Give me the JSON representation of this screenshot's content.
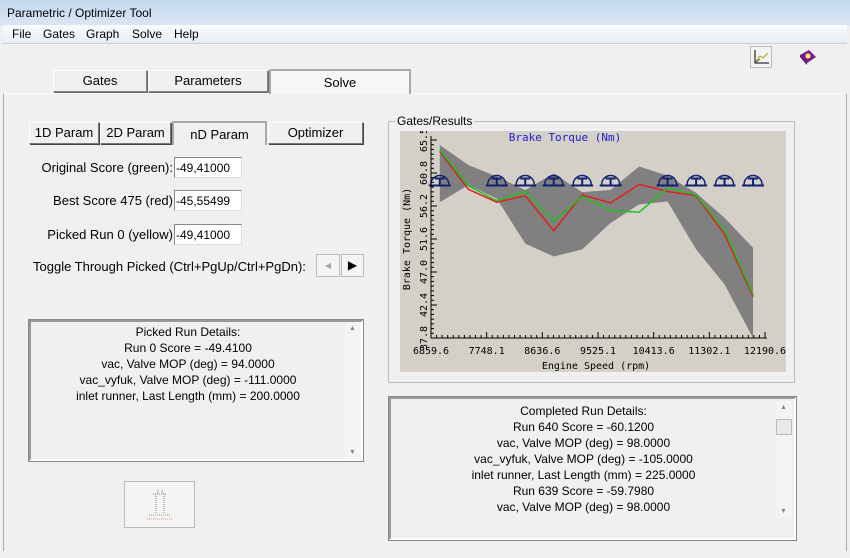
{
  "window": {
    "title": "Parametric / Optimizer Tool"
  },
  "menu": [
    "File",
    "Gates",
    "Graph",
    "Solve",
    "Help"
  ],
  "toolbar": {
    "icons": [
      "graph-icon",
      "help-book-icon"
    ]
  },
  "tabs": [
    {
      "label": "Gates",
      "selected": false
    },
    {
      "label": "Parameters",
      "selected": false
    },
    {
      "label": "Solve",
      "selected": true
    }
  ],
  "subtabs": [
    {
      "label": "1D Param",
      "selected": false
    },
    {
      "label": "2D Param",
      "selected": false
    },
    {
      "label": "nD Param",
      "selected": true
    },
    {
      "label": "Optimizer",
      "selected": false
    }
  ],
  "scores": {
    "original_label": "Original Score (green):",
    "original_value": "-49,41000",
    "best_label": "Best Score 475 (red)",
    "best_value": "-45,55499",
    "picked_label": "Picked Run 0 (yellow)",
    "picked_value": "-49,41000",
    "toggle_label": "Toggle Through Picked (Ctrl+PgUp/Ctrl+PgDn):"
  },
  "picked_details": [
    "Picked Run Details:",
    "Run 0  Score = -49.4100",
    "vac, Valve MOP (deg) = 94.0000",
    "vac_vyfuk, Valve MOP (deg) = -111.0000",
    "inlet runner, Last Length (mm) = 200.0000"
  ],
  "group_label": "Gates/Results",
  "completed_details": [
    "Completed Run Details:",
    "Run 640  Score = -60.1200",
    "vac, Valve MOP (deg) = 98.0000",
    "vac_vyfuk, Valve MOP (deg) = -105.0000",
    "inlet runner, Last Length (mm) = 225.0000",
    "Run 639  Score = -59.7980",
    "vac, Valve MOP (deg) = 98.0000"
  ],
  "chart_data": {
    "type": "line",
    "title": "Brake Torque (Nm)",
    "xlabel": "Engine Speed (rpm)",
    "ylabel": "Brake Torque (Nm)",
    "xlim": [
      6859.6,
      12190.6
    ],
    "ylim": [
      37.8,
      65.5
    ],
    "xticks": [
      "6859.6",
      "7748.1",
      "8636.6",
      "9525.1",
      "10413.6",
      "11302.1",
      "12190.6"
    ],
    "yticks": [
      "37.8",
      "42.4",
      "47.0",
      "51.6",
      "56.2",
      "60.8",
      "65.5"
    ],
    "x": [
      7000,
      7455,
      7909,
      8364,
      8818,
      9273,
      9727,
      10182,
      10636,
      11091,
      11545,
      12000
    ],
    "series": [
      {
        "color": "#e02020",
        "values": [
          63.9,
          58.6,
          56.8,
          57.7,
          52.8,
          57.8,
          56.7,
          59.3,
          58.3,
          57.7,
          52.3,
          43.6
        ]
      },
      {
        "color": "#20c020",
        "values": [
          64.1,
          59.1,
          57.0,
          58.3,
          54.1,
          57.6,
          55.6,
          55.4,
          58.8,
          57.8,
          52.9,
          43.9
        ]
      }
    ],
    "band": {
      "color": "#808080",
      "upper": [
        64.8,
        62.0,
        60.4,
        58.5,
        60.8,
        58.2,
        58.5,
        61.8,
        60.5,
        58.1,
        54.6,
        50.4
      ],
      "lower": [
        56.8,
        59.2,
        57.3,
        51.0,
        49.2,
        50.2,
        53.9,
        56.5,
        56.9,
        50.2,
        45.3,
        37.8
      ]
    },
    "gate_level": 59.7
  }
}
